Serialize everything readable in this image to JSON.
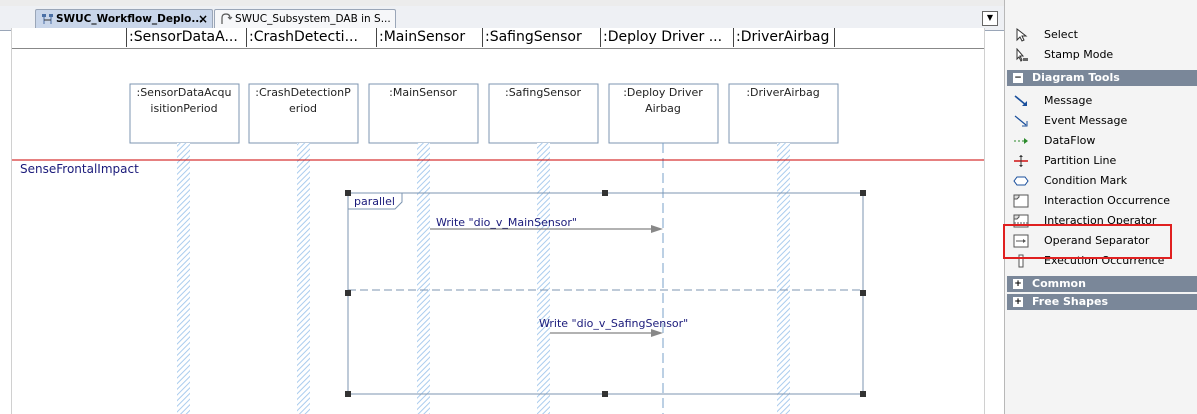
{
  "tabs": [
    {
      "label": "SWUC_Workflow_Deplo...",
      "close": "×",
      "icon": "sequence-diagram-icon"
    },
    {
      "label": "SWUC_Subsystem_DAB in S...",
      "icon": "subsystem-icon"
    }
  ],
  "header": {
    "lifelines": [
      ":SensorDataA...",
      ":CrashDetecti...",
      ":MainSensor",
      ":SafingSensor",
      ":Deploy Driver ...",
      ":DriverAirbag"
    ]
  },
  "diagram": {
    "lifelines": [
      {
        "line1": ":SensorDataAcqu",
        "line2": "isitionPeriod"
      },
      {
        "line1": ":CrashDetectionP",
        "line2": "eriod"
      },
      {
        "line1": ":MainSensor",
        "line2": ""
      },
      {
        "line1": ":SafingSensor",
        "line2": ""
      },
      {
        "line1": ":Deploy Driver",
        "line2": "Airbag"
      },
      {
        "line1": ":DriverAirbag",
        "line2": ""
      }
    ],
    "partition_label": "SenseFrontalImpact",
    "fragment_operator": "parallel",
    "messages": [
      {
        "label": "Write \"dio_v_MainSensor\""
      },
      {
        "label": "Write \"dio_v_SafingSensor\""
      }
    ],
    "colors": {
      "partition": "#cc0000",
      "text": "#1a1a7a",
      "arrow": "#666666"
    }
  },
  "palette": {
    "top_items": [
      {
        "label": "Select",
        "icon": "cursor-arrow-icon"
      },
      {
        "label": "Stamp Mode",
        "icon": "stamp-icon"
      }
    ],
    "sections": [
      {
        "title": "Diagram Tools",
        "expanded": true,
        "items": [
          {
            "label": "Message",
            "icon": "message-arrow-icon"
          },
          {
            "label": "Event Message",
            "icon": "event-message-icon"
          },
          {
            "label": "DataFlow",
            "icon": "dataflow-icon"
          },
          {
            "label": "Partition Line",
            "icon": "partition-line-icon"
          },
          {
            "label": "Condition Mark",
            "icon": "condition-mark-icon"
          },
          {
            "label": "Interaction Occurrence",
            "icon": "interaction-occurrence-icon"
          },
          {
            "label": "Interaction Operator",
            "icon": "interaction-operator-icon"
          },
          {
            "label": "Operand Separator",
            "icon": "operand-separator-icon"
          },
          {
            "label": "Execution Occurrence",
            "icon": "execution-occurrence-icon"
          }
        ]
      },
      {
        "title": "Common",
        "expanded": false
      },
      {
        "title": "Free Shapes",
        "expanded": false
      }
    ],
    "highlight_color": "#e02020"
  }
}
